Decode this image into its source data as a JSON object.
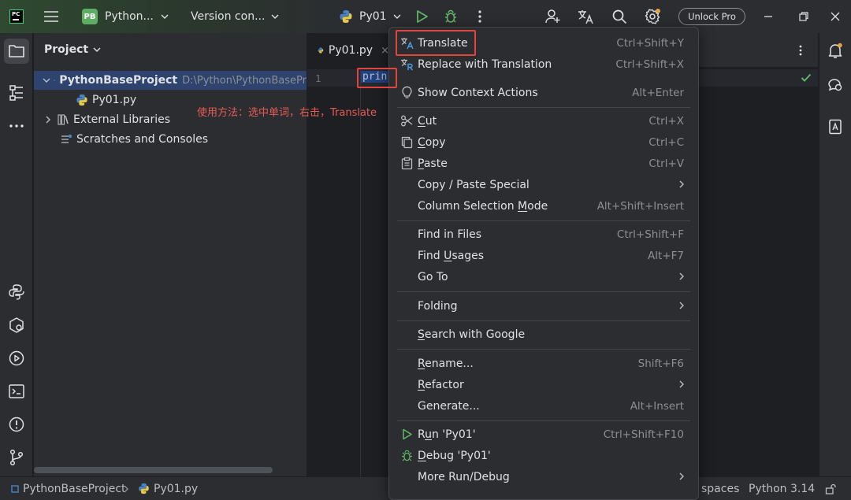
{
  "titlebar": {
    "project_badge": "PB",
    "project_name": "Python...",
    "vcs_label": "Version con...",
    "run_config": "Py01",
    "unlock_label": "Unlock Pro"
  },
  "project_panel": {
    "title": "Project",
    "tree": [
      {
        "label": "PythonBaseProject",
        "path": "D:\\Python\\PythonBasePr",
        "expanded": true,
        "selected": true
      },
      {
        "label": "Py01.py"
      },
      {
        "label": "External Libraries",
        "expanded": false
      },
      {
        "label": "Scratches and Consoles"
      }
    ]
  },
  "annotation": "使用方法：选中单词，右击，Translate",
  "editor": {
    "tab_label": "Py01.py",
    "tab_close": "×",
    "line_number": "1",
    "code": "prin"
  },
  "menu": {
    "items": [
      {
        "label": "Translate",
        "shortcut": "Ctrl+Shift+Y",
        "icon": "translate-icon"
      },
      {
        "label": "Replace with Translation",
        "shortcut": "Ctrl+Shift+X",
        "icon": "replace-translation-icon"
      },
      {
        "label": "Show Context Actions",
        "shortcut": "Alt+Enter",
        "icon": "lightbulb-icon"
      },
      {
        "label": "Cut",
        "shortcut": "Ctrl+X",
        "icon": "scissors-icon"
      },
      {
        "label": "Copy",
        "shortcut": "Ctrl+C",
        "icon": "copy-icon"
      },
      {
        "label": "Paste",
        "shortcut": "Ctrl+V",
        "icon": "paste-icon"
      },
      {
        "label": "Copy / Paste Special",
        "shortcut": "",
        "submenu": true
      },
      {
        "label": "Column Selection Mode",
        "shortcut": "Alt+Shift+Insert"
      },
      {
        "label": "Find in Files",
        "shortcut": "Ctrl+Shift+F"
      },
      {
        "label": "Find Usages",
        "shortcut": "Alt+F7"
      },
      {
        "label": "Go To",
        "shortcut": "",
        "submenu": true
      },
      {
        "label": "Folding",
        "shortcut": "",
        "submenu": true
      },
      {
        "label": "Search with Google",
        "shortcut": ""
      },
      {
        "label": "Rename...",
        "shortcut": "Shift+F6"
      },
      {
        "label": "Refactor",
        "shortcut": "",
        "submenu": true
      },
      {
        "label": "Generate...",
        "shortcut": "Alt+Insert"
      },
      {
        "label": "Run 'Py01'",
        "shortcut": "Ctrl+Shift+F10",
        "icon": "run-icon"
      },
      {
        "label": "Debug 'Py01'",
        "shortcut": "",
        "icon": "debug-icon"
      },
      {
        "label": "More Run/Debug",
        "shortcut": "",
        "submenu": true
      }
    ]
  },
  "statusbar": {
    "breadcrumb_project": "PythonBaseProject",
    "breadcrumb_file": "Py01.py",
    "indent": "spaces",
    "interpreter": "Python 3.14"
  },
  "colors": {
    "accent_green": "#5fad65",
    "selection_blue": "#2e436e",
    "annotation_red": "#e55b55"
  }
}
